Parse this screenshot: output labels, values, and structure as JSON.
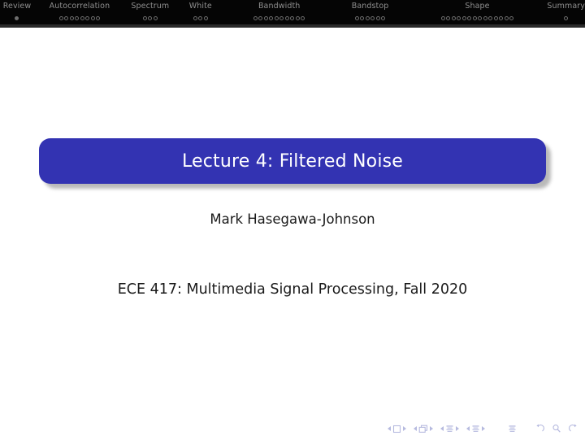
{
  "header": {
    "sections": [
      {
        "label": "Review",
        "slides": 1,
        "current": 0
      },
      {
        "label": "Autocorrelation",
        "slides": 8,
        "current": -1
      },
      {
        "label": "Spectrum",
        "slides": 3,
        "current": -1
      },
      {
        "label": "White",
        "slides": 3,
        "current": -1
      },
      {
        "label": "Bandwidth",
        "slides": 10,
        "current": -1
      },
      {
        "label": "Bandstop",
        "slides": 6,
        "current": -1
      },
      {
        "label": "Shape",
        "slides": 14,
        "current": -1
      },
      {
        "label": "Summary",
        "slides": 1,
        "current": -1
      }
    ],
    "background_color": "#050505",
    "label_color": "#8f8f8f",
    "dot_color": "#6e6e6e"
  },
  "title_block": {
    "title": "Lecture 4:  Filtered Noise",
    "background_color": "#3333b2",
    "text_color": "#ffffff"
  },
  "author": "Mark Hasegawa-Johnson",
  "course": "ECE 417:  Multimedia Signal Processing, Fall 2020",
  "navigation_symbols": {
    "color": "#b6badf",
    "items": [
      {
        "name": "first-slide",
        "glyph": "slide-icon"
      },
      {
        "name": "first-frame",
        "glyph": "frame-icon"
      },
      {
        "name": "first-subsection",
        "glyph": "subsection-icon"
      },
      {
        "name": "first-section",
        "glyph": "section-icon"
      },
      {
        "name": "first-doc",
        "glyph": "doc-icon"
      },
      {
        "name": "back",
        "glyph": "back-arrow-icon"
      },
      {
        "name": "search",
        "glyph": "magnifier-icon"
      },
      {
        "name": "forward",
        "glyph": "forward-arrow-icon"
      }
    ]
  }
}
